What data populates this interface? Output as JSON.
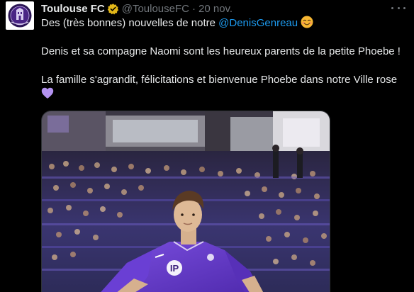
{
  "tweet": {
    "display_name": "Toulouse FC",
    "handle": "@ToulouseFC",
    "separator": "·",
    "date": "20 nov.",
    "text": {
      "line1_prefix": "Des (très bonnes) nouvelles de notre ",
      "mention": "@DenisGenreau",
      "line2": "Denis et sa compagne Naomi sont les heureux parents de la petite Phoebe !",
      "line3": "La famille s'agrandit, félicitations et bienvenue Phoebe dans notre Ville rose"
    },
    "emojis": [
      "smiling-face-emoji",
      "purple-heart-emoji"
    ],
    "media": {
      "jersey_sponsor": "IP"
    }
  },
  "colors": {
    "background": "#000000",
    "text": "#e7e9ea",
    "secondary": "#71767b",
    "link": "#1d9bf0",
    "verified_badge": "#e2b719",
    "heart": "#b392f0",
    "club_purple": "#5b2b9f"
  },
  "icons": [
    "club-crest-icon",
    "verified-badge-icon",
    "more-options-icon"
  ]
}
